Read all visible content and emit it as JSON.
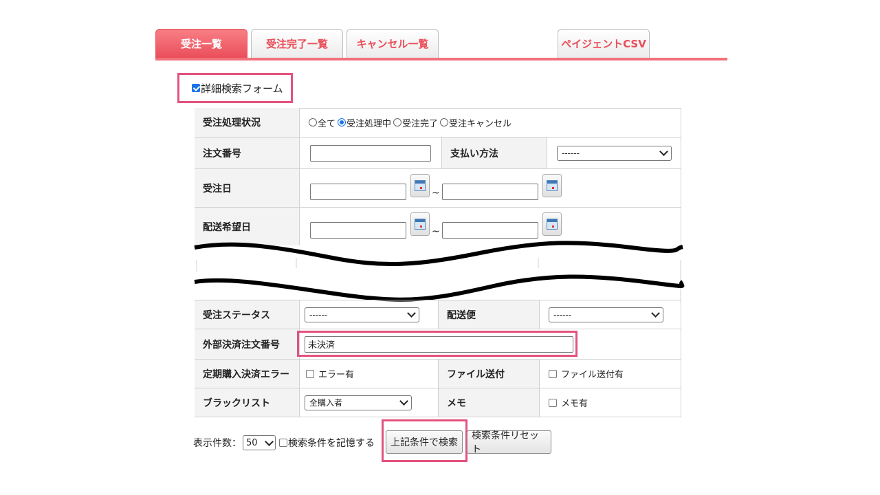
{
  "tabs": [
    {
      "label": "受注一覧",
      "active": true
    },
    {
      "label": "受注完了一覧",
      "active": false
    },
    {
      "label": "キャンセル一覧",
      "active": false
    },
    {
      "label": "ペイジェントCSV",
      "active": false
    }
  ],
  "detail_search": {
    "label": "詳細検索フォーム",
    "checked": true
  },
  "form": {
    "order_status": {
      "label": "受注処理状況",
      "options": [
        "全て",
        "受注処理中",
        "受注完了",
        "受注キャンセル"
      ],
      "selected": "受注処理中"
    },
    "order_number": {
      "label": "注文番号",
      "value": ""
    },
    "payment_method": {
      "label": "支払い方法",
      "value": "------"
    },
    "order_date": {
      "label": "受注日",
      "range_sep": "~"
    },
    "delivery_date": {
      "label": "配送希望日",
      "range_sep": "~"
    },
    "order_state": {
      "label": "受注ステータス",
      "value": "------"
    },
    "delivery_service": {
      "label": "配送便",
      "value": "------"
    },
    "external_payment": {
      "label": "外部決済注文番号",
      "value": "未決済"
    },
    "subscription_error": {
      "label": "定期購入決済エラー",
      "checkbox_label": "エラー有"
    },
    "file_send": {
      "label": "ファイル送付",
      "checkbox_label": "ファイル送付有"
    },
    "blacklist": {
      "label": "ブラックリスト",
      "value": "全購入者"
    },
    "memo": {
      "label": "メモ",
      "checkbox_label": "メモ有"
    }
  },
  "footer": {
    "display_count_label": "表示件数：",
    "display_count_value": "50",
    "remember_label": "検索条件を記憶する",
    "search_button": "上記条件で検索",
    "reset_button": "検索条件リセット"
  },
  "colors": {
    "accent": "#ea4e5a",
    "highlight": "#e2527e"
  }
}
